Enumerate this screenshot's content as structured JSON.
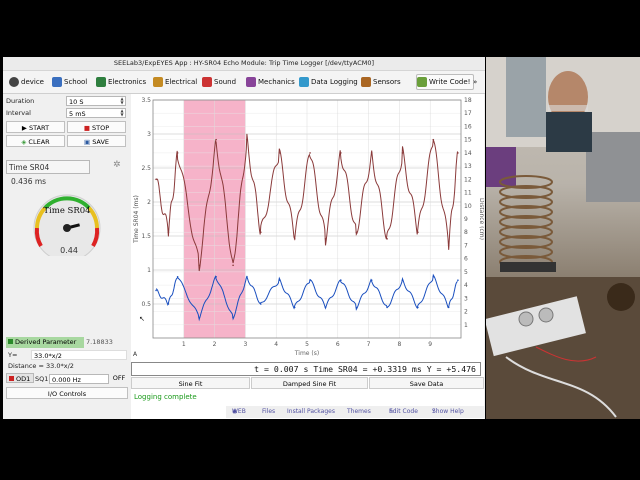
{
  "window": {
    "title": "SEELab3/ExpEYES App : HY-SR04 Echo Module: Trip Time Logger  [/dev/ttyACM0]"
  },
  "menu": [
    {
      "label": "device",
      "icon": "gear-icon",
      "color": "#444444"
    },
    {
      "label": "School",
      "icon": "school-icon",
      "color": "#3a6fbf"
    },
    {
      "label": "Electronics",
      "icon": "electronics-icon",
      "color": "#2f7f3f"
    },
    {
      "label": "Electrical",
      "icon": "electrical-icon",
      "color": "#c48a22"
    },
    {
      "label": "Sound",
      "icon": "sound-icon",
      "color": "#cc3333"
    },
    {
      "label": "Mechanics",
      "icon": "mechanics-icon",
      "color": "#884499"
    },
    {
      "label": "Data Logging",
      "icon": "data-logging-icon",
      "color": "#3399cc"
    },
    {
      "label": "Sensors",
      "icon": "sensors-icon",
      "color": "#aa6622"
    },
    {
      "label": "Write Code!",
      "icon": "code-icon",
      "color": "#6a9f3a"
    }
  ],
  "controls": {
    "duration_label": "Duration",
    "duration_value": "10 S",
    "interval_label": "Interval",
    "interval_value": "5 mS",
    "start": "START",
    "stop": "STOP",
    "clear": "CLEAR",
    "save": "SAVE"
  },
  "meter": {
    "name": "Time SR04",
    "value_text": "0.436 ms",
    "gauge_title": "Time SR04",
    "gauge_value": "0.44",
    "gauge_fraction": 0.78
  },
  "derived": {
    "checkbox_label": "Derived Parameter",
    "result": "7.18833",
    "y_label": "Y=",
    "y_expr": "33.0*x/2",
    "distance_text": "Distance = 33.0*x/2"
  },
  "od1": {
    "label": "OD1",
    "sq1_label": "SQ1",
    "freq": "0.000 Hz",
    "off": "OFF"
  },
  "io_controls": "I/O Controls",
  "plot": {
    "left_axis_label": "Time SR04 (ms)",
    "right_axis_label": "Distance (cm)",
    "x_axis_label": "Time (s)",
    "readout": "t = 0.007 s   Time SR04 = +0.3319 ms Y = +5.476"
  },
  "chart_data": {
    "type": "line",
    "xlabel": "Time (s)",
    "ylabel": "Time SR04 (ms)",
    "y2label": "Distance (cm)",
    "xlim": [
      0,
      10
    ],
    "ylim": [
      0,
      3.5
    ],
    "y2lim": [
      0,
      18
    ],
    "x_ticks": [
      "1",
      "2",
      "3",
      "4",
      "5",
      "6",
      "7",
      "8",
      "9"
    ],
    "y_ticks": [
      "0.5",
      "1",
      "1.5",
      "2",
      "2.5",
      "3",
      "3.5"
    ],
    "y2_ticks": [
      "1",
      "2",
      "3",
      "4",
      "5",
      "6",
      "7",
      "8",
      "9",
      "10",
      "11",
      "12",
      "13",
      "14",
      "15",
      "16",
      "17",
      "18"
    ],
    "highlight": {
      "x_start": 1,
      "x_end": 3,
      "color": "#f4a6bf"
    },
    "series": [
      {
        "color": "#8a3a3a",
        "axis": "right",
        "x": [
          0.1,
          0.5,
          0.8,
          1.5,
          2.05,
          2.6,
          3.05,
          3.5,
          4.1,
          4.6,
          5.1,
          5.6,
          6.1,
          6.6,
          7.1,
          7.6,
          8.1,
          8.6,
          9.1,
          9.6,
          9.9
        ],
        "values": [
          12,
          8,
          14,
          5.5,
          15,
          5.5,
          15,
          8,
          14,
          7.5,
          14,
          7.5,
          14,
          8,
          14,
          7.5,
          14,
          8,
          15,
          7,
          14
        ]
      },
      {
        "color": "#1a4fbf",
        "axis": "left",
        "x": [
          0.1,
          0.5,
          0.8,
          1.5,
          2.05,
          2.6,
          3.05,
          3.5,
          4.1,
          4.6,
          5.1,
          5.6,
          6.1,
          6.6,
          7.1,
          7.6,
          8.1,
          8.6,
          9.1,
          9.6,
          9.9
        ],
        "values": [
          0.7,
          0.5,
          0.9,
          0.3,
          0.9,
          0.3,
          0.9,
          0.5,
          0.85,
          0.45,
          0.85,
          0.45,
          0.85,
          0.45,
          0.85,
          0.45,
          0.85,
          0.45,
          0.9,
          0.45,
          0.85
        ]
      }
    ]
  },
  "buttons": {
    "sine_fit": "Sine Fit",
    "damped": "Damped Sine Fit",
    "save_data": "Save Data"
  },
  "status": "Logging complete",
  "footer": {
    "web": "WEB",
    "files": "Files",
    "install": "Install Packages",
    "themes": "Themes",
    "edit": "Edit Code",
    "help": "Show Help"
  }
}
